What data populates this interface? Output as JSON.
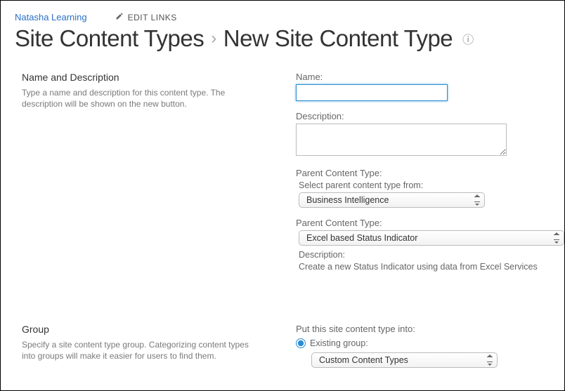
{
  "topbar": {
    "site_link": "Natasha Learning",
    "edit_links": "EDIT LINKS"
  },
  "title": {
    "parent": "Site Content Types",
    "current": "New Site Content Type"
  },
  "section1": {
    "heading": "Name and Description",
    "desc": "Type a name and description for this content type. The description will be shown on the new button.",
    "name_label": "Name:",
    "name_value": "",
    "description_label": "Description:",
    "description_value": "",
    "parent_ct_label": "Parent Content Type:",
    "select_from_label": "Select parent content type from:",
    "select_from_value": "Business Intelligence",
    "parent_ct_label2": "Parent Content Type:",
    "parent_ct_value": "Excel based Status Indicator",
    "desc_label2": "Description:",
    "desc_value2": "Create a new Status Indicator using data from Excel Services"
  },
  "section2": {
    "heading": "Group",
    "desc": "Specify a site content type group. Categorizing content types into groups will make it easier for users to find them.",
    "put_into_label": "Put this site content type into:",
    "existing_group_label": "Existing group:",
    "existing_group_value": "Custom Content Types"
  }
}
